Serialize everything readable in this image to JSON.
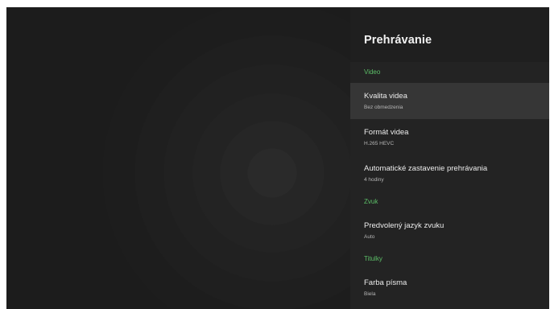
{
  "settings_panel": {
    "title": "Prehrávanie",
    "sections": [
      {
        "label": "Video",
        "items": [
          {
            "title": "Kvalita videa",
            "value": "Bez obmedzenia",
            "focused": true
          },
          {
            "title": "Formát videa",
            "value": "H.265 HEVC"
          },
          {
            "title": "Automatické zastavenie prehrávania",
            "value": "4 hodiny"
          }
        ]
      },
      {
        "label": "Zvuk",
        "items": [
          {
            "title": "Predvolený jazyk zvuku",
            "value": "Auto"
          }
        ]
      },
      {
        "label": "Titulky",
        "items": [
          {
            "title": "Farba písma",
            "value": "Biela"
          }
        ]
      }
    ]
  },
  "colors": {
    "background": "#1c1c1c",
    "panel": "#232323",
    "panel_header": "#1f1f1f",
    "focused_item": "#363636",
    "section_accent": "#5cbf68",
    "primary_text": "#ececec",
    "secondary_text": "#b5b5b5"
  }
}
